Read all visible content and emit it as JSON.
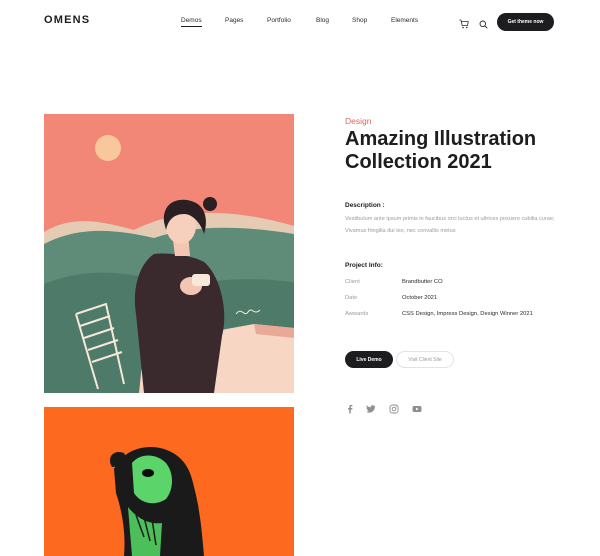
{
  "header": {
    "logo": "OMENS",
    "nav": [
      {
        "label": "Demos",
        "active": true
      },
      {
        "label": "Pages",
        "active": false
      },
      {
        "label": "Portfolio",
        "active": false
      },
      {
        "label": "Blog",
        "active": false
      },
      {
        "label": "Shop",
        "active": false
      },
      {
        "label": "Elements",
        "active": false
      }
    ],
    "icons": [
      "cart-icon",
      "search-icon"
    ],
    "cta_label": "Get theme now"
  },
  "project": {
    "category": "Design",
    "title": "Amazing Illustration Collection 2021",
    "description_heading": "Description :",
    "description": "Vestibulum ante ipsum primis in faucibus orci luctus et ultrices posuere cubilia curae; Vivamus fringilla dui leo, nec convallis metus",
    "info_heading": "Project Info:",
    "info": [
      {
        "label": "Client",
        "value": "Brandbutter CO"
      },
      {
        "label": "Date",
        "value": "October 2021"
      },
      {
        "label": "Awwards",
        "value": "CSS Design, Impress Design, Design Winner 2021"
      }
    ],
    "buttons": {
      "live": "Live Demo",
      "visit": "Visit Client Site"
    },
    "social": [
      "facebook-icon",
      "twitter-icon",
      "instagram-icon",
      "youtube-icon"
    ]
  },
  "colors": {
    "accent": "#e0675f",
    "dark": "#1d1d1f",
    "muted": "#9b9b9b",
    "art1_bg": "#f28778",
    "art2_bg": "#fd6a1f"
  }
}
